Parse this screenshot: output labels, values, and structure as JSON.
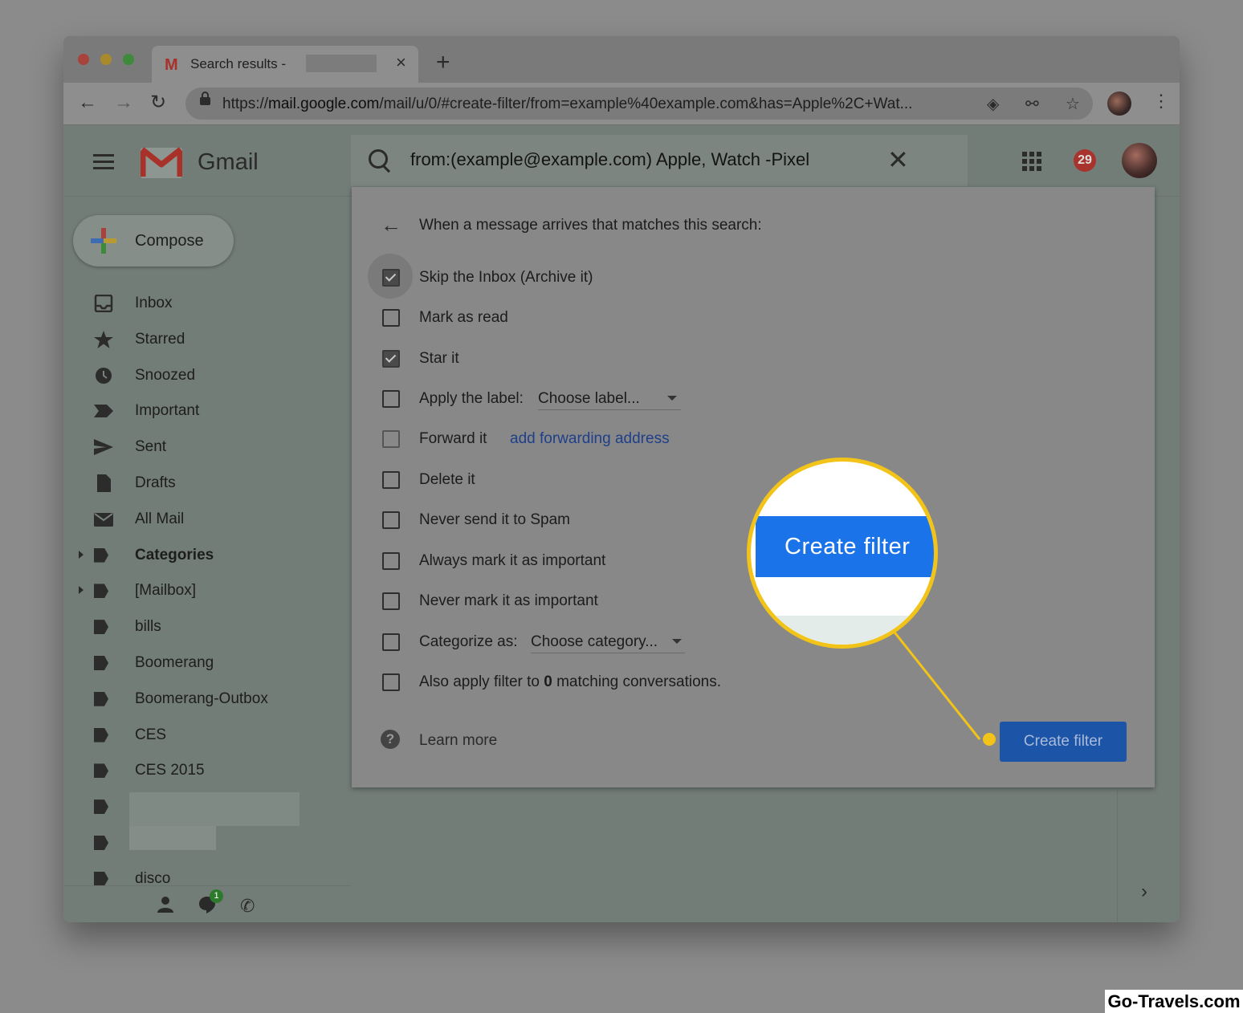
{
  "browser": {
    "tab_title": "Search results -",
    "tab_close": "×",
    "new_tab": "+",
    "url_prefix": "https://",
    "url_host": "mail.google.com",
    "url_path": "/mail/u/0/#create-filter/from=example%40example.com&has=Apple%2C+Wat..."
  },
  "gmail": {
    "app_name": "Gmail",
    "search_query": "from:(example@example.com) Apple, Watch -Pixel",
    "notification_count": "29"
  },
  "sidebar": {
    "compose_label": "Compose",
    "items": [
      {
        "label": "Inbox",
        "icon": "inbox-icon"
      },
      {
        "label": "Starred",
        "icon": "star-icon"
      },
      {
        "label": "Snoozed",
        "icon": "clock-icon"
      },
      {
        "label": "Important",
        "icon": "important-icon"
      },
      {
        "label": "Sent",
        "icon": "send-icon"
      },
      {
        "label": "Drafts",
        "icon": "draft-icon"
      },
      {
        "label": "All Mail",
        "icon": "mail-icon"
      },
      {
        "label": "Categories",
        "icon": "label-icon"
      },
      {
        "label": "[Mailbox]",
        "icon": "label-icon"
      },
      {
        "label": "bills",
        "icon": "label-icon"
      },
      {
        "label": "Boomerang",
        "icon": "label-icon"
      },
      {
        "label": "Boomerang-Outbox",
        "icon": "label-icon"
      },
      {
        "label": "CES",
        "icon": "label-icon"
      },
      {
        "label": "CES 2015",
        "icon": "label-icon"
      },
      {
        "label": "",
        "icon": "label-icon"
      },
      {
        "label": "",
        "icon": "label-icon"
      },
      {
        "label": "disco",
        "icon": "label-icon"
      }
    ],
    "hangouts_badge": "1"
  },
  "filter_dialog": {
    "heading": "When a message arrives that matches this search:",
    "options": [
      {
        "label": "Skip the Inbox (Archive it)",
        "checked": true
      },
      {
        "label": "Mark as read",
        "checked": false
      },
      {
        "label": "Star it",
        "checked": true
      },
      {
        "label": "Apply the label:",
        "checked": false
      },
      {
        "label": "Forward it",
        "checked": false
      },
      {
        "label": "Delete it",
        "checked": false
      },
      {
        "label": "Never send it to Spam",
        "checked": false
      },
      {
        "label": "Always mark it as important",
        "checked": false
      },
      {
        "label": "Never mark it as important",
        "checked": false
      },
      {
        "label": "Categorize as:",
        "checked": false
      }
    ],
    "label_select": "Choose label...",
    "forward_link": "add forwarding address",
    "category_select": "Choose category...",
    "also_apply_prefix": "Also apply filter to",
    "also_apply_count": "0",
    "also_apply_suffix": "matching conversations.",
    "learn_more": "Learn more",
    "create_button": "Create filter"
  },
  "callout": {
    "zoom_label": "Create filter",
    "accent_color": "#f2c318"
  },
  "watermark": "Go-Travels.com"
}
